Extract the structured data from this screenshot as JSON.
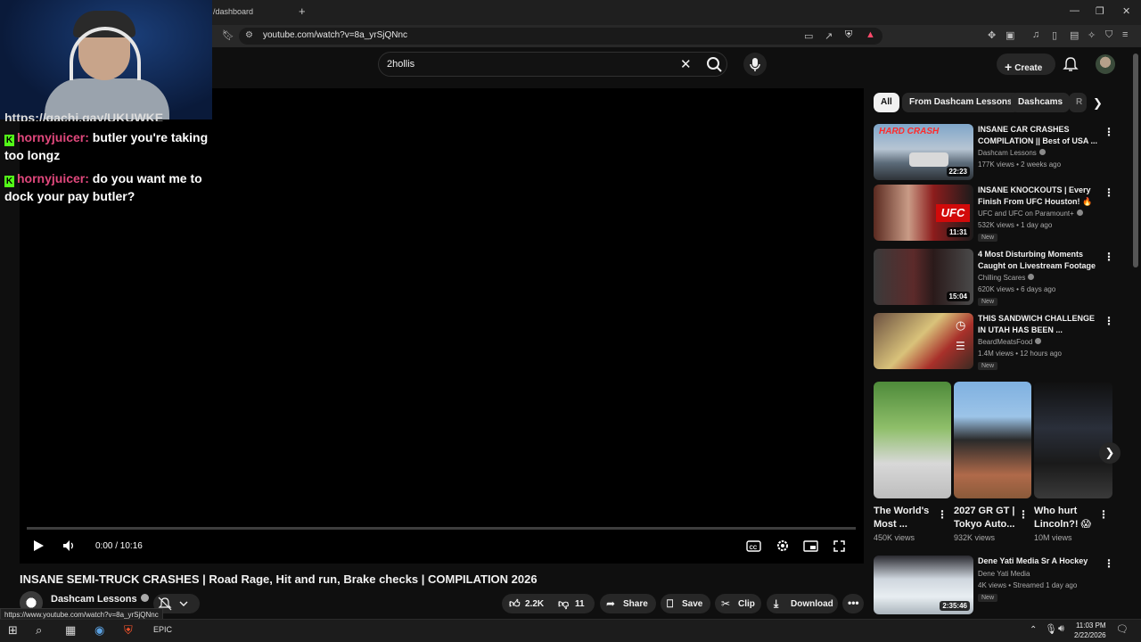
{
  "browser": {
    "tab_title": "/dashboard",
    "new_tab": "+",
    "url": "youtube.com/watch?v=8a_yrSjQNnc",
    "status_url": "https://www.youtube.com/watch?v=8a_yrSjQNnc"
  },
  "masthead": {
    "search_value": "2hollis",
    "create_label": "Create"
  },
  "chat": {
    "cut_line": "https://gachi.gay/UKUWKE",
    "messages": [
      {
        "user": "hornyjuicer:",
        "text": "butler you're taking too longz"
      },
      {
        "user": "hornyjuicer:",
        "text": "do you want me to dock your pay butler?"
      }
    ]
  },
  "player": {
    "time": "0:00 / 10:16",
    "progress": 0
  },
  "video": {
    "title": "INSANE SEMI-TRUCK CRASHES | Road Rage, Hit and run, Brake checks | COMPILATION 2026",
    "channel": "Dashcam Lessons",
    "likes": "2.2K",
    "dislikes": "11",
    "share": "Share",
    "save": "Save",
    "clip": "Clip",
    "download": "Download"
  },
  "chips": [
    "All",
    "From Dashcam Lessons",
    "Dashcams",
    "R"
  ],
  "recommendations": [
    {
      "title": "INSANE CAR CRASHES COMPILATION || Best of USA ...",
      "channel": "Dashcam Lessons",
      "meta": "177K views • 2 weeks ago",
      "duration": "22:23",
      "badge": "",
      "thumb_text": "HARD CRASH"
    },
    {
      "title": "INSANE KNOCKOUTS | Every Finish From UFC Houston! 🔥",
      "channel": "UFC and UFC on Paramount+",
      "meta": "532K views • 1 day ago",
      "duration": "11:31",
      "badge": "New",
      "thumb_text": "UFC"
    },
    {
      "title": "4 Most Disturbing Moments Caught on Livestream Footage",
      "channel": "Chilling Scares",
      "meta": "620K views • 6 days ago",
      "duration": "15:04",
      "badge": "New",
      "thumb_text": ""
    },
    {
      "title": "THIS SANDWICH CHALLENGE IN UTAH HAS BEEN ...",
      "channel": "BeardMeatsFood",
      "meta": "1.4M views • 12 hours ago",
      "duration": "",
      "badge": "New",
      "thumb_text": ""
    },
    {
      "title": "Dene Yati Media Sr A Hockey",
      "channel": "Dene Yati Media",
      "meta": "4K views • Streamed 1 day ago",
      "duration": "2:35:46",
      "badge": "New",
      "thumb_text": ""
    }
  ],
  "shorts": [
    {
      "title": "The World's Most ...",
      "views": "450K views"
    },
    {
      "title": "2027 GR GT | Tokyo Auto...",
      "views": "932K views"
    },
    {
      "title": "Who hurt Lincoln?! 😱",
      "views": "10M views"
    }
  ],
  "taskbar": {
    "time": "11:03 PM",
    "date": "2/22/2026"
  },
  "colors": {
    "background": "#0f0f0f",
    "chip_active": "#f1f1f1",
    "kick_green": "#53fc18",
    "chat_user": "#e0487c"
  }
}
